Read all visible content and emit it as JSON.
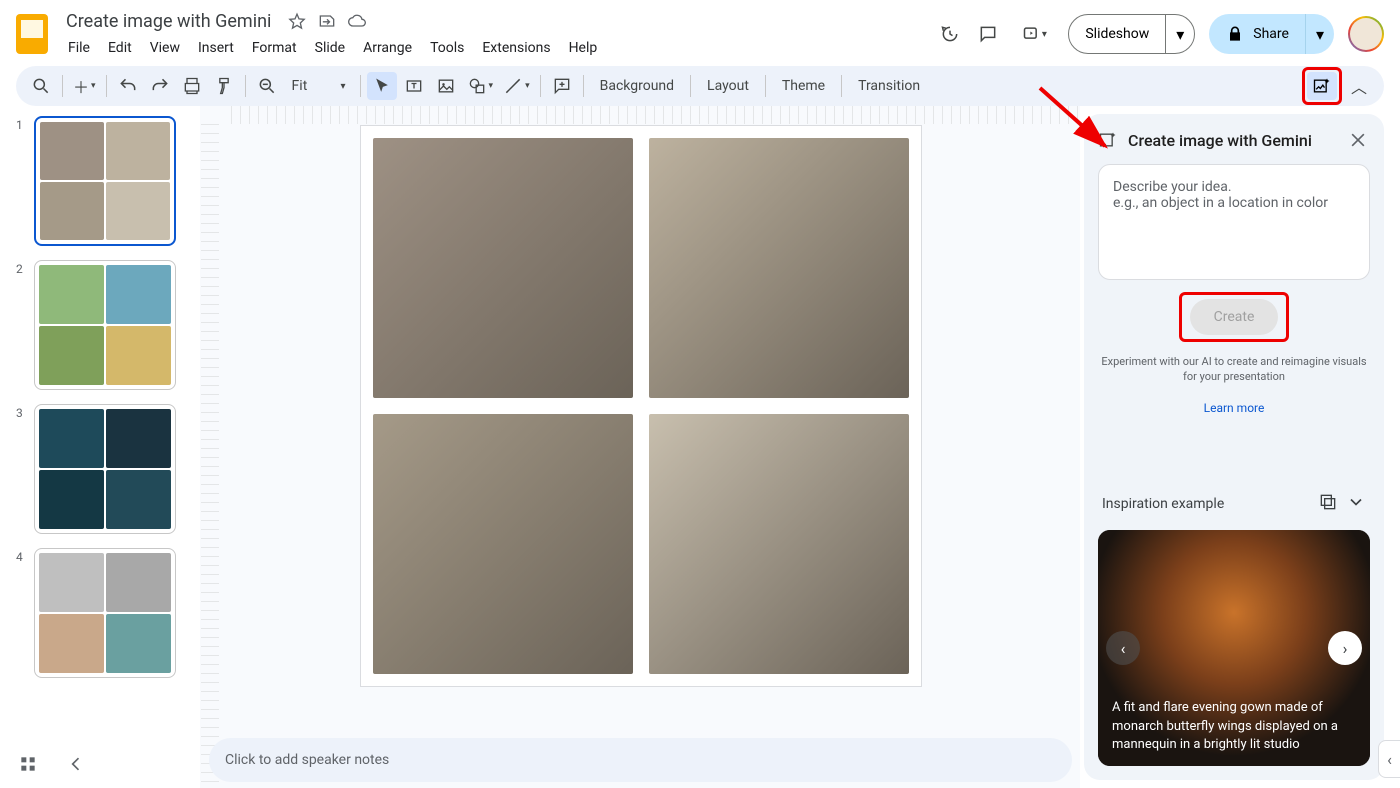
{
  "doc": {
    "title": "Create image with Gemini"
  },
  "menus": [
    "File",
    "Edit",
    "View",
    "Insert",
    "Format",
    "Slide",
    "Arrange",
    "Tools",
    "Extensions",
    "Help"
  ],
  "top_actions": {
    "slideshow": "Slideshow",
    "share": "Share"
  },
  "toolbar": {
    "zoom": "Fit",
    "background": "Background",
    "layout": "Layout",
    "theme": "Theme",
    "transition": "Transition"
  },
  "thumbnails": [
    {
      "n": "1",
      "selected": true,
      "palette": [
        "#9e9184",
        "#bdb29f",
        "#a59a88",
        "#c8bfae"
      ]
    },
    {
      "n": "2",
      "selected": false,
      "palette": [
        "#8fb97a",
        "#6ca8bd",
        "#7fa05a",
        "#d4b86a"
      ]
    },
    {
      "n": "3",
      "selected": false,
      "palette": [
        "#1e4a5a",
        "#1a3340",
        "#143844",
        "#224a58"
      ]
    },
    {
      "n": "4",
      "selected": false,
      "palette": [
        "#bfbfbf",
        "#a8a8a8",
        "#c9a88a",
        "#6aa0a0"
      ]
    }
  ],
  "slide_images": [
    "#9e9184",
    "#bdb29f",
    "#a59a88",
    "#c8bfae"
  ],
  "notes_placeholder": "Click to add speaker notes",
  "panel": {
    "title": "Create image with Gemini",
    "prompt_line1": "Describe your idea.",
    "prompt_line2": "e.g., an object in a location in color",
    "create": "Create",
    "help": "Experiment with our AI to create and reimagine visuals for your presentation",
    "learn": "Learn more",
    "inspiration_title": "Inspiration example",
    "inspiration_text": "A fit and flare evening gown made of monarch butterfly wings displayed on a mannequin in a brightly lit studio"
  }
}
